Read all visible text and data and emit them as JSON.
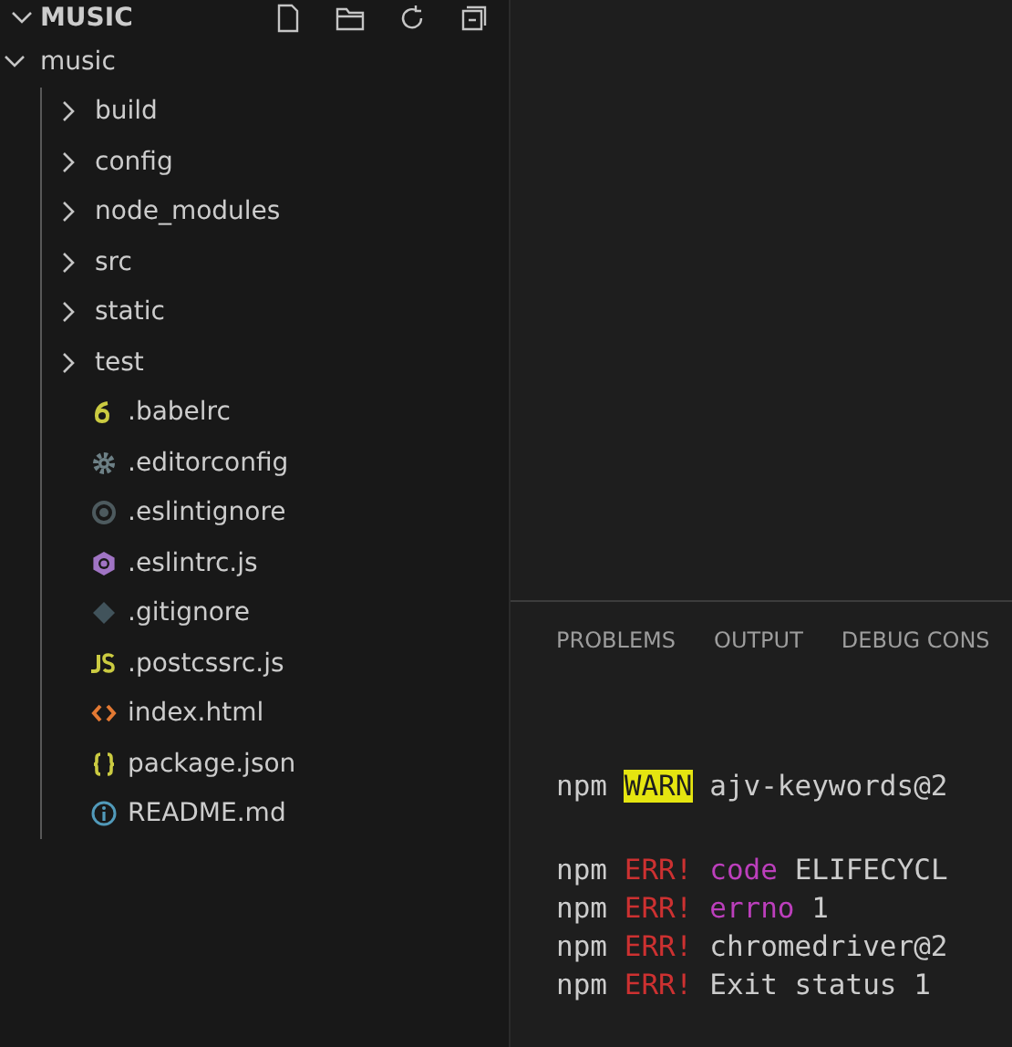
{
  "explorer": {
    "title": "MUSIC",
    "expanded": true,
    "tree": [
      {
        "label": "music",
        "kind": "folder",
        "expanded": true,
        "children": [
          {
            "label": "build",
            "kind": "folder",
            "expanded": false
          },
          {
            "label": "config",
            "kind": "folder",
            "expanded": false
          },
          {
            "label": "node_modules",
            "kind": "folder",
            "expanded": false
          },
          {
            "label": "src",
            "kind": "folder",
            "expanded": false
          },
          {
            "label": "static",
            "kind": "folder",
            "expanded": false
          },
          {
            "label": "test",
            "kind": "folder",
            "expanded": false
          },
          {
            "label": ".babelrc",
            "kind": "babel"
          },
          {
            "label": ".editorconfig",
            "kind": "gear"
          },
          {
            "label": ".eslintignore",
            "kind": "ignore"
          },
          {
            "label": ".eslintrc.js",
            "kind": "eslint"
          },
          {
            "label": ".gitignore",
            "kind": "git"
          },
          {
            "label": ".postcssrc.js",
            "kind": "js"
          },
          {
            "label": "index.html",
            "kind": "html"
          },
          {
            "label": "package.json",
            "kind": "json"
          },
          {
            "label": "README.md",
            "kind": "info"
          }
        ]
      }
    ]
  },
  "panel": {
    "tabs": [
      {
        "label": "PROBLEMS",
        "selected": false
      },
      {
        "label": "OUTPUT",
        "selected": false
      },
      {
        "label": "DEBUG CONS",
        "selected": false
      }
    ],
    "terminal": [
      [
        [
          {
            "text": "npm",
            "kind": "plain"
          },
          {
            "text": "WARN",
            "kind": "warn"
          },
          {
            "text": "ajv-keywords@2",
            "kind": "plain"
          }
        ]
      ],
      [
        [
          {
            "text": "npm",
            "kind": "plain"
          },
          {
            "text": "ERR!",
            "kind": "err"
          },
          {
            "text": "code",
            "kind": "key"
          },
          {
            "text": "ELIFECYCL",
            "kind": "plain"
          }
        ],
        [
          {
            "text": "npm",
            "kind": "plain"
          },
          {
            "text": "ERR!",
            "kind": "err"
          },
          {
            "text": "errno",
            "kind": "key"
          },
          {
            "text": "1",
            "kind": "plain"
          }
        ],
        [
          {
            "text": "npm",
            "kind": "plain"
          },
          {
            "text": "ERR!",
            "kind": "err"
          },
          {
            "text": "chromedriver@2",
            "kind": "plain"
          }
        ],
        [
          {
            "text": "npm",
            "kind": "plain"
          },
          {
            "text": "ERR!",
            "kind": "err"
          },
          {
            "text": "Exit status 1",
            "kind": "plain"
          }
        ]
      ]
    ]
  }
}
